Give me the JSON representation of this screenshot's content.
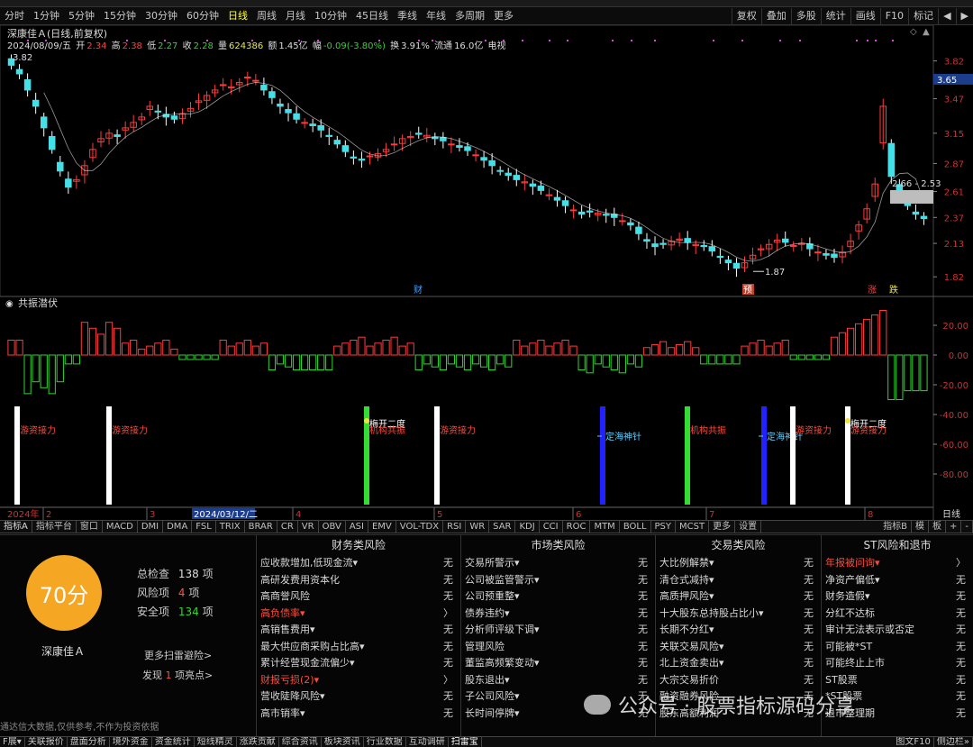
{
  "period_bar": {
    "items": [
      "分时",
      "1分钟",
      "5分钟",
      "15分钟",
      "30分钟",
      "60分钟",
      "日线",
      "周线",
      "月线",
      "10分钟",
      "45日线",
      "季线",
      "年线",
      "多周期",
      "更多"
    ],
    "active": "日线",
    "right_items": [
      "复权",
      "叠加",
      "多股",
      "统计",
      "画线",
      "F10",
      "标记",
      "◀",
      "▶"
    ]
  },
  "quote": {
    "title": "深康佳Ａ(日线,前复权)",
    "date": "2024/08/09/五",
    "open_label": "开",
    "open": "2.34",
    "high_label": "高",
    "high": "2.38",
    "low_label": "低",
    "low": "2.27",
    "close_label": "收",
    "close": "2.28",
    "volume_label": "量",
    "volume": "624386",
    "amount_label": "额",
    "amount": "1.45亿",
    "change_label": "幅",
    "change": "-0.09(-3.80%)",
    "turnover_label": "换",
    "turnover": "3.91%",
    "float_label": "流通",
    "float_cap": "16.0亿",
    "extra": "电视"
  },
  "price_axis": [
    "3.82",
    "3.65",
    "3.47",
    "3.15",
    "2.87",
    "2.61",
    "2.37",
    "2.13",
    "1.82"
  ],
  "current_price_tag": "3.65",
  "chart_annotations": {
    "top_left_price": "3.82",
    "low_price": "1.87",
    "range_label": "2.66 - 2.53",
    "event_cai": "财",
    "event_yu": "预",
    "event_zhang": "涨",
    "event_die": "跌"
  },
  "indicator_panel": {
    "title": "共振潜伏",
    "axis": [
      "20.00",
      "0.00",
      "-20.00",
      "-40.00",
      "-60.00",
      "-80.00"
    ],
    "signals": [
      {
        "label": "游资接力",
        "color": "#ffffff"
      },
      {
        "label": "游资接力",
        "color": "#ffffff"
      },
      {
        "label": "梅开二度",
        "color": "#33dd33"
      },
      {
        "label": "机构共振",
        "color": "#33dd33"
      },
      {
        "label": "游资接力",
        "color": "#ffffff"
      },
      {
        "label": "定海神针",
        "color": "#2222ff"
      },
      {
        "label": "机构共振",
        "color": "#33dd33"
      },
      {
        "label": "定海神针",
        "color": "#2222ff"
      },
      {
        "label": "游资接力",
        "color": "#ffffff"
      },
      {
        "label": "梅开二度",
        "color": "#ffffff"
      },
      {
        "label": "游资接力",
        "color": "#ffffff"
      }
    ]
  },
  "time_axis": {
    "year_label": "2024年",
    "months": [
      "2",
      "3",
      "4",
      "5",
      "6",
      "7",
      "8"
    ],
    "highlight_date": "2024/03/12/二",
    "right_label": "日线"
  },
  "indicator_tabs": [
    "指标A",
    "指标平台",
    "窗口",
    "MACD",
    "DMI",
    "DMA",
    "FSL",
    "TRIX",
    "BRAR",
    "CR",
    "VR",
    "OBV",
    "ASI",
    "EMV",
    "VOL-TDX",
    "RSI",
    "WR",
    "SAR",
    "KDJ",
    "CCI",
    "ROC",
    "MTM",
    "BOLL",
    "PSY",
    "MCST",
    "更多",
    "设置"
  ],
  "indicator_tabs_right": [
    "指标B",
    "模",
    "板",
    "+",
    "-"
  ],
  "risk": {
    "score": "70分",
    "stock_name": "深康佳Ａ",
    "total_label": "总检查",
    "total": "138",
    "total_unit": "项",
    "risk_label": "风险项",
    "risk_count": "4",
    "risk_unit": "项",
    "safe_label": "安全项",
    "safe_count": "134",
    "safe_unit": "项",
    "more_link": "更多扫雷避险>",
    "find_prefix": "发现",
    "find_count": "1",
    "find_suffix": "项亮点>",
    "disclaimer": "通达信大数据,仅供参考,不作为投资依据",
    "columns": [
      {
        "title": "财务类风险",
        "rows": [
          {
            "label": "应收款增加,低现金流▾",
            "value": "无",
            "hl": false
          },
          {
            "label": "高研发费用资本化",
            "value": "无",
            "hl": false
          },
          {
            "label": "高商誉风险",
            "value": "无",
            "hl": false
          },
          {
            "label": "高负债率▾",
            "value": "〉",
            "hl": true
          },
          {
            "label": "高销售费用▾",
            "value": "无",
            "hl": false
          },
          {
            "label": "最大供应商采购占比高▾",
            "value": "无",
            "hl": false
          },
          {
            "label": "累计经营现金流偏少▾",
            "value": "无",
            "hl": false
          },
          {
            "label": "财报亏损(2)▾",
            "value": "〉",
            "hl": true
          },
          {
            "label": "营收陡降风险▾",
            "value": "无",
            "hl": false
          },
          {
            "label": "高市销率▾",
            "value": "无",
            "hl": false
          }
        ]
      },
      {
        "title": "市场类风险",
        "rows": [
          {
            "label": "交易所警示▾",
            "value": "无",
            "hl": false
          },
          {
            "label": "公司被监管警示▾",
            "value": "无",
            "hl": false
          },
          {
            "label": "公司预重整▾",
            "value": "无",
            "hl": false
          },
          {
            "label": "债券违约▾",
            "value": "无",
            "hl": false
          },
          {
            "label": "分析师评级下调▾",
            "value": "无",
            "hl": false
          },
          {
            "label": "管理风险",
            "value": "无",
            "hl": false
          },
          {
            "label": "董监高频繁变动▾",
            "value": "无",
            "hl": false
          },
          {
            "label": "股东退出▾",
            "value": "无",
            "hl": false
          },
          {
            "label": "子公司风险▾",
            "value": "无",
            "hl": false
          },
          {
            "label": "长时间停牌▾",
            "value": "无",
            "hl": false
          }
        ]
      },
      {
        "title": "交易类风险",
        "rows": [
          {
            "label": "大比例解禁▾",
            "value": "无",
            "hl": false
          },
          {
            "label": "清仓式减持▾",
            "value": "无",
            "hl": false
          },
          {
            "label": "高质押风险▾",
            "value": "无",
            "hl": false
          },
          {
            "label": "十大股东总持股占比小▾",
            "value": "无",
            "hl": false
          },
          {
            "label": "长期不分红▾",
            "value": "无",
            "hl": false
          },
          {
            "label": "关联交易风险▾",
            "value": "无",
            "hl": false
          },
          {
            "label": "北上资金卖出▾",
            "value": "无",
            "hl": false
          },
          {
            "label": "大宗交易折价",
            "value": "无",
            "hl": false
          },
          {
            "label": "融资融券风险",
            "value": "无",
            "hl": false
          },
          {
            "label": "股东高额利润",
            "value": "无",
            "hl": false
          }
        ]
      },
      {
        "title": "ST风险和退市",
        "rows": [
          {
            "label": "年报被问询▾",
            "value": "〉",
            "hl": true
          },
          {
            "label": "净资产偏低▾",
            "value": "无",
            "hl": false
          },
          {
            "label": "财务造假▾",
            "value": "无",
            "hl": false
          },
          {
            "label": "分红不达标",
            "value": "无",
            "hl": false
          },
          {
            "label": "审计无法表示或否定",
            "value": "无",
            "hl": false
          },
          {
            "label": "可能被*ST",
            "value": "无",
            "hl": false
          },
          {
            "label": "可能终止上市",
            "value": "无",
            "hl": false
          },
          {
            "label": "ST股票",
            "value": "无",
            "hl": false
          },
          {
            "label": "*ST股票",
            "value": "无",
            "hl": false
          },
          {
            "label": "退市整理期",
            "value": "无",
            "hl": false
          }
        ]
      }
    ]
  },
  "status_bar": [
    "F展▾",
    "关联报价",
    "盘面分析",
    "境外资金",
    "资金统计",
    "短线精灵",
    "涨跌贡献",
    "综合资讯",
    "板块资讯",
    "行业数据",
    "互动调研",
    "扫雷宝"
  ],
  "status_bar_active": "扫雷宝",
  "status_bar_right": [
    "图文F10",
    "侧边栏»"
  ],
  "watermark": "公众号 · 股票指标源码分享",
  "colors": {
    "up": "#ff3b3b",
    "down": "#44e0e8",
    "ma": "#ffffff",
    "score": "#f5a623",
    "background": "#000000"
  }
}
